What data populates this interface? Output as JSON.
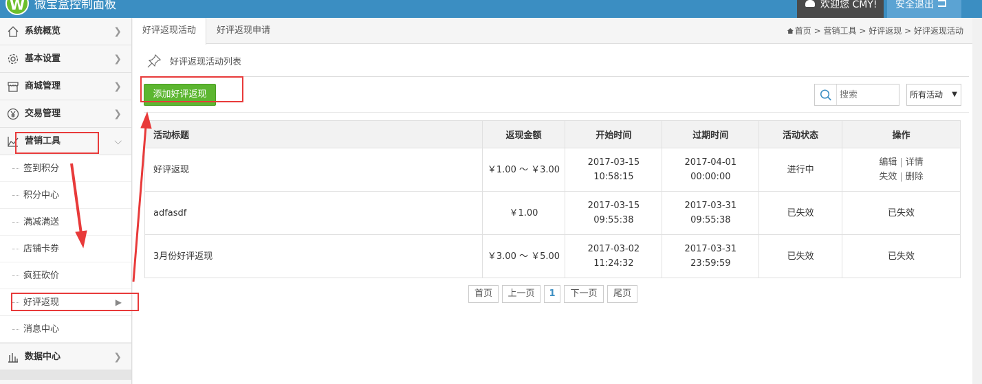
{
  "app": {
    "title": "微宝盒控制面板",
    "logo_letter": "W"
  },
  "topbar": {
    "welcome": "欢迎您 CMY!",
    "logout": "安全退出"
  },
  "sidebar": {
    "menus_top": [
      {
        "label": "系统概览",
        "icon": "home-icon"
      },
      {
        "label": "基本设置",
        "icon": "gear-icon"
      },
      {
        "label": "商城管理",
        "icon": "store-icon"
      },
      {
        "label": "交易管理",
        "icon": "yen-icon"
      }
    ],
    "marketing": {
      "label": "营销工具",
      "icon": "chart-icon"
    },
    "sub_items": [
      "签到积分",
      "积分中心",
      "满减满送",
      "店铺卡券",
      "疯狂砍价",
      "好评返现",
      "消息中心"
    ],
    "data_center": {
      "label": "数据中心",
      "icon": "bar-chart-icon"
    }
  },
  "tabs": [
    "好评返现活动",
    "好评返现申请"
  ],
  "breadcrumb": {
    "home": "首页",
    "sep": ">",
    "items": [
      "营销工具",
      "好评返现",
      "好评返现活动"
    ]
  },
  "section": {
    "title": "好评返现活动列表"
  },
  "toolbar": {
    "add_label": "添加好评返现",
    "search_placeholder": "搜索",
    "filter_value": "所有活动"
  },
  "table": {
    "headers": [
      "活动标题",
      "返现金额",
      "开始时间",
      "过期时间",
      "活动状态",
      "操作"
    ],
    "rows": [
      {
        "title": "好评返现",
        "amount": "￥1.00 ～ ￥3.00",
        "start_date": "2017-03-15",
        "start_time": "10:58:15",
        "end_date": "2017-04-01",
        "end_time": "00:00:00",
        "status": "进行中",
        "ops": [
          "编辑",
          "详情",
          "失效",
          "删除"
        ]
      },
      {
        "title": "adfasdf",
        "amount": "￥1.00",
        "start_date": "2017-03-15",
        "start_time": "09:55:38",
        "end_date": "2017-03-31",
        "end_time": "09:55:38",
        "status": "已失效",
        "op_text": "已失效"
      },
      {
        "title": "3月份好评返现",
        "amount": "￥3.00 ～ ￥5.00",
        "start_date": "2017-03-02",
        "start_time": "11:24:32",
        "end_date": "2017-03-31",
        "end_time": "23:59:59",
        "status": "已失效",
        "op_text": "已失效"
      }
    ]
  },
  "pager": {
    "first": "首页",
    "prev": "上一页",
    "current": "1",
    "next": "下一页",
    "last": "尾页"
  },
  "colors": {
    "topbar": "#3b8ec2",
    "accent_green": "#5cb630",
    "annotation_red": "#e83a3a"
  }
}
